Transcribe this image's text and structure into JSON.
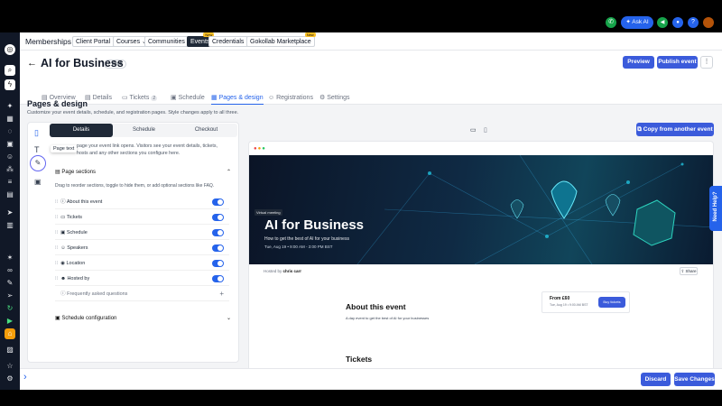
{
  "topbar": {
    "ai_label": "Ask AI"
  },
  "nav": {
    "memberships": "Memberships",
    "items": [
      "Client Portal ⌄",
      "Courses ⌄",
      "Communities ⌄",
      "Events",
      "Credentials ⌄",
      "Gokollab Marketplace"
    ],
    "badges": {
      "events": "New",
      "marketplace": "New"
    }
  },
  "header": {
    "title": "AI for Business",
    "status": "Draft",
    "preview": "Preview",
    "publish": "Publish event",
    "tabs": [
      "Overview",
      "Details",
      "Tickets",
      "Schedule",
      "Pages & design",
      "Registrations",
      "Settings"
    ],
    "tickets_count": "2"
  },
  "page": {
    "title": "Pages & design",
    "subtitle": "Customize your event details, schedule, and registration pages. Style changes apply to all three.",
    "copy_button": "Copy from another event"
  },
  "editor": {
    "segments": [
      "Details",
      "Schedule",
      "Checkout"
    ],
    "tooltip": "Page text",
    "intro": "page your event link opens. Visitors see your event details, tickets, hosts and any other sections you configure here.",
    "sections_title": "Page sections",
    "sections_help": "Drag to reorder sections, toggle to hide them, or add optional sections like FAQ.",
    "rows": [
      "About this event",
      "Tickets",
      "Schedule",
      "Speakers",
      "Location",
      "Hosted by"
    ],
    "faq": "Frequently asked questions",
    "schedule_config": "Schedule configuration"
  },
  "preview": {
    "tag": "Virtual meeting",
    "title": "AI for Business",
    "tagline": "How to get the best of AI for your business",
    "date": "Tue, Aug 19 • 9:00 AM - 3:00 PM BST",
    "hosted_by": "Hosted by",
    "host": "chris carr",
    "share": "Share",
    "about_title": "About this event",
    "about_text": "A day event to get the best of AI for your businesses",
    "price_from": "From £60",
    "price_date": "Tue, Aug 19 • 9:00 AM BST",
    "buy": "Buy tickets",
    "tickets_title": "Tickets"
  },
  "footer": {
    "discard": "Discard",
    "save": "Save Changes",
    "help": "Need Help?"
  },
  "colors": {
    "accent": "#3b5bdb",
    "toggle": "#2563eb",
    "dark": "#1f2937"
  }
}
